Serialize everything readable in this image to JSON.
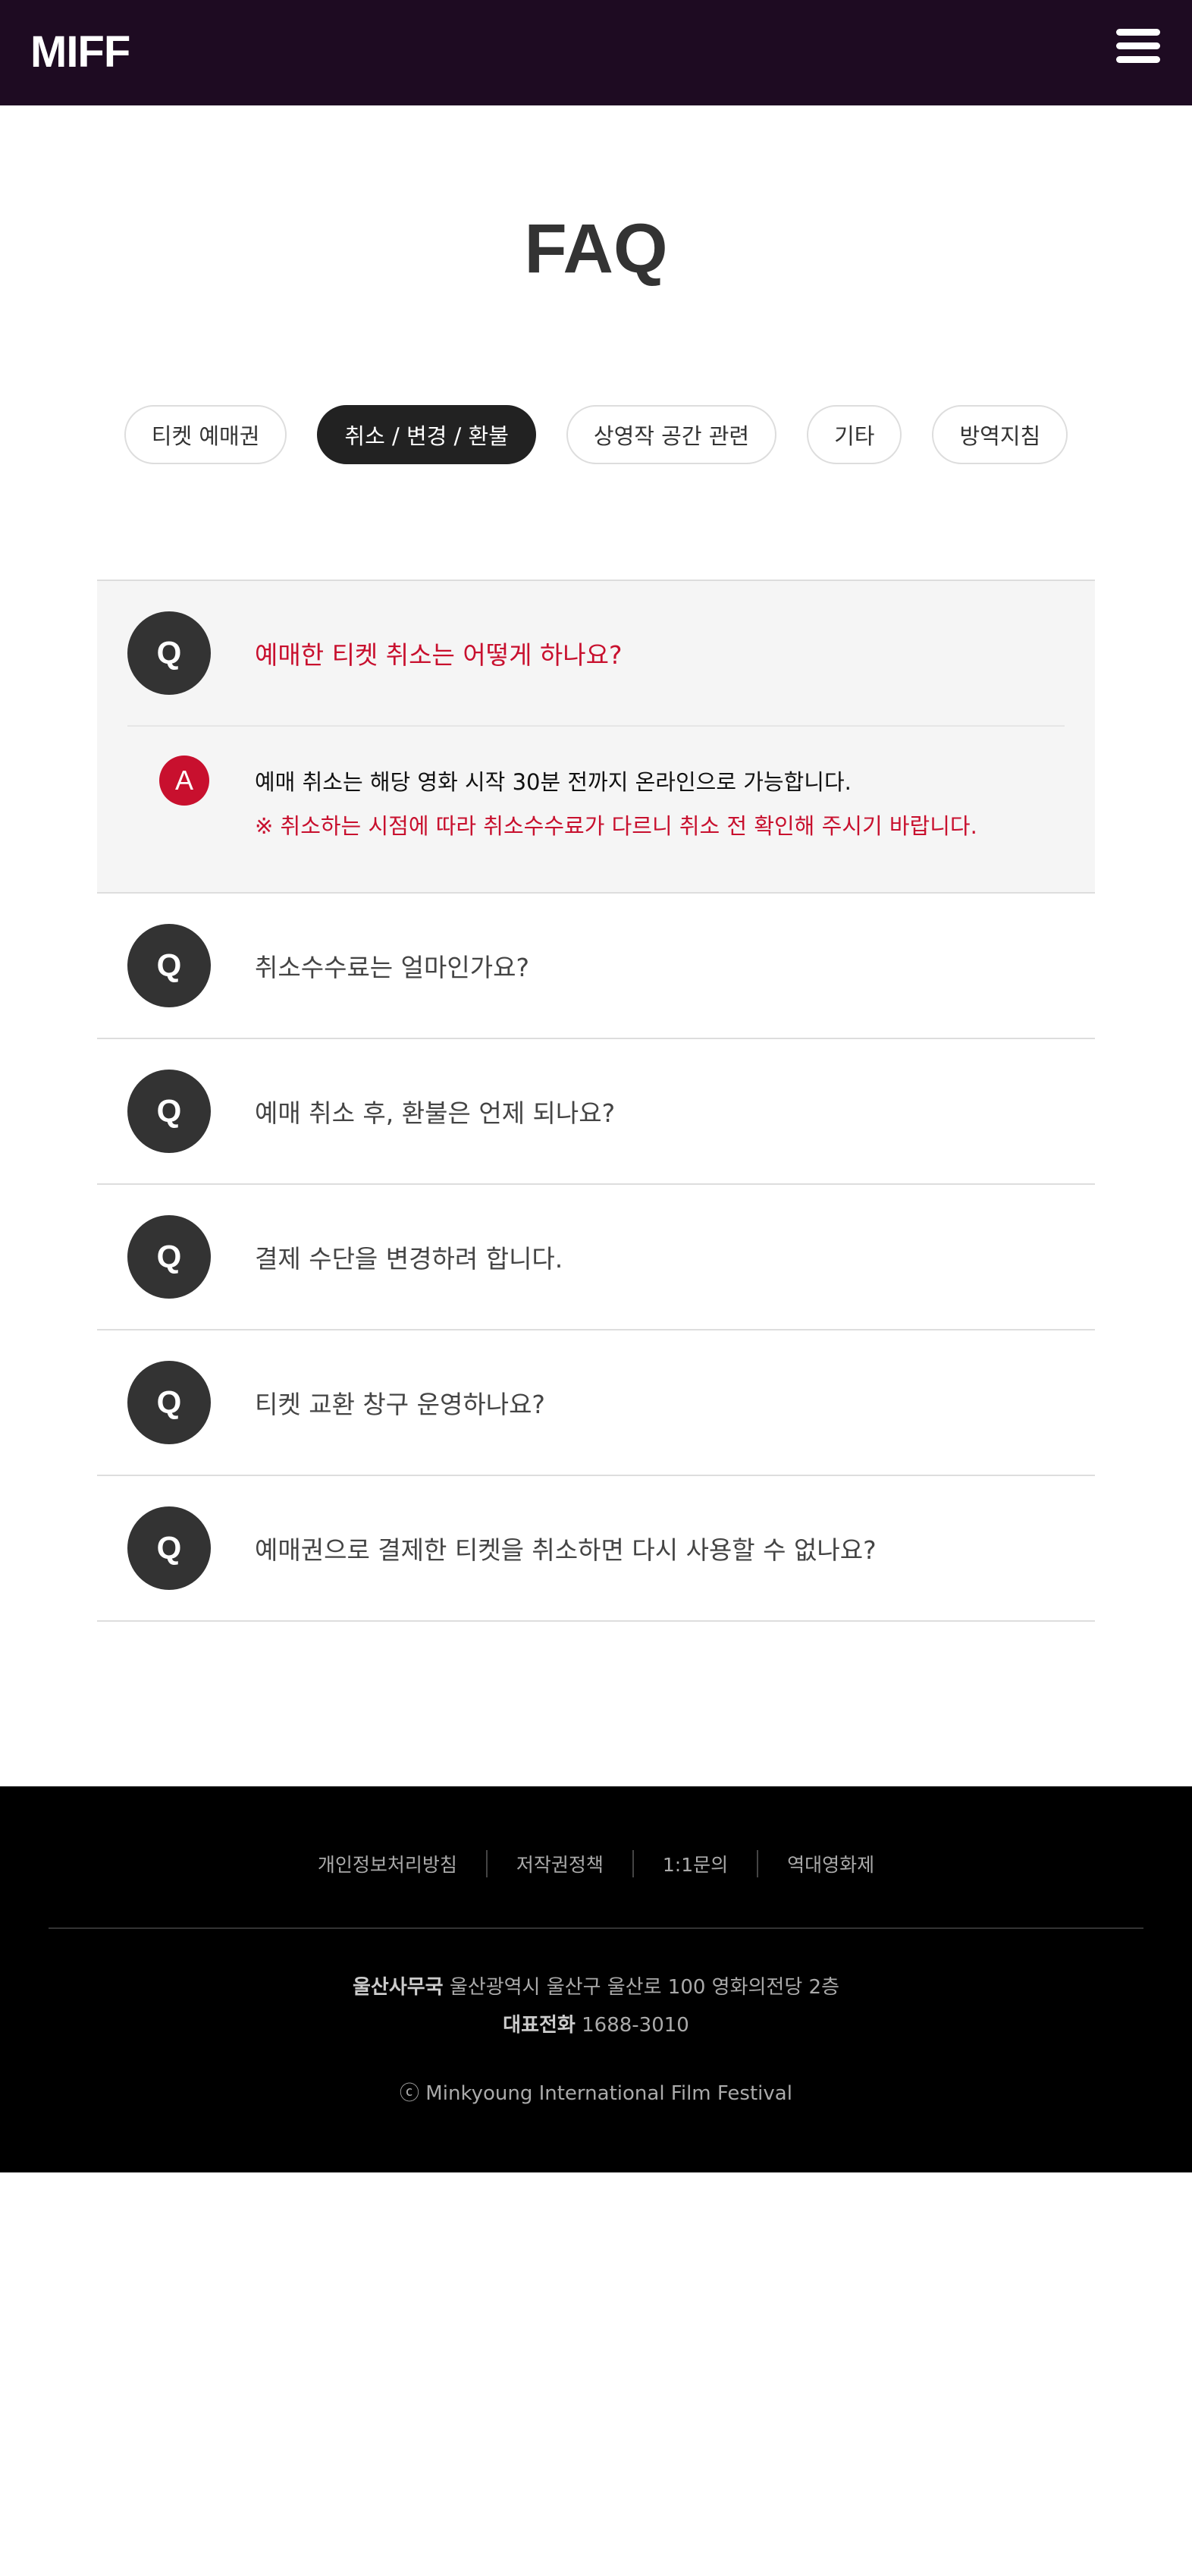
{
  "header": {
    "logo": "MIFF",
    "menu_icon": "hamburger-menu-icon"
  },
  "page": {
    "title": "FAQ"
  },
  "tabs": [
    {
      "label": "티켓 예매권",
      "active": false
    },
    {
      "label": "취소 / 변경 / 환불",
      "active": true
    },
    {
      "label": "상영작 공간 관련",
      "active": false
    },
    {
      "label": "기타",
      "active": false
    },
    {
      "label": "방역지침",
      "active": false
    }
  ],
  "faq": {
    "q_badge": "Q",
    "a_badge": "A",
    "items": [
      {
        "question": "예매한 티켓 취소는 어떻게 하나요?",
        "open": true,
        "answer": "예매 취소는 해당 영화 시작 30분 전까지 온라인으로 가능합니다.",
        "answer_note": "※ 취소하는 시점에 따라 취소수수료가 다르니 취소 전 확인해 주시기 바랍니다."
      },
      {
        "question": "취소수수료는 얼마인가요?",
        "open": false
      },
      {
        "question": "예매 취소 후, 환불은 언제 되나요?",
        "open": false
      },
      {
        "question": "결제 수단을 변경하려 합니다.",
        "open": false
      },
      {
        "question": "티켓 교환 창구 운영하나요?",
        "open": false
      },
      {
        "question": "예매권으로 결제한 티켓을 취소하면 다시 사용할 수 없나요?",
        "open": false
      }
    ]
  },
  "footer": {
    "links": [
      "개인정보처리방침",
      "저작권정책",
      "1:1문의",
      "역대영화제"
    ],
    "office_label": "울산사무국",
    "office_address": "울산광역시 울산구 울산로 100 영화의전당 2층",
    "phone_label": "대표전화",
    "phone_number": "1688-3010",
    "copyright": "ⓒ Minkyoung International Film Festival"
  },
  "colors": {
    "header_bg": "#1e0b22",
    "accent_red": "#c8102e",
    "active_tab_bg": "#222222",
    "footer_bg": "#000000"
  }
}
